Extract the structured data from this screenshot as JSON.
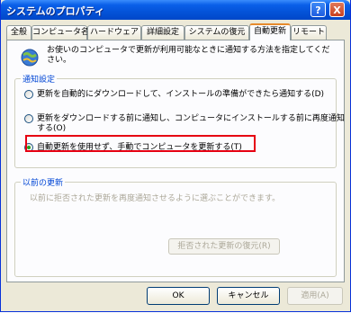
{
  "window": {
    "title": "システムのプロパティ",
    "help_label": "?",
    "close_label": "X"
  },
  "tabs": [
    {
      "label": "全般"
    },
    {
      "label": "コンピュータ名"
    },
    {
      "label": "ハードウェア"
    },
    {
      "label": "詳細設定"
    },
    {
      "label": "システムの復元"
    },
    {
      "label": "自動更新",
      "active": true
    },
    {
      "label": "リモート"
    }
  ],
  "description": "お使いのコンピュータで更新が利用可能なときに通知する方法を指定してください。",
  "notify_group": {
    "label": "通知設定",
    "options": [
      {
        "label": "更新を自動的にダウンロードして、インストールの準備ができたら通知する(D)",
        "checked": false
      },
      {
        "label_line1": "更新をダウンロードする前に通知し、コンピュータにインストールする前に再度通知",
        "label_line2": "する(O)",
        "checked": false
      },
      {
        "label": "自動更新を使用せず、手動でコンピュータを更新する(T)",
        "checked": true
      }
    ]
  },
  "previous_group": {
    "label": "以前の更新",
    "text": "以前に拒否された更新を再度通知させるように選ぶことができます。",
    "restore_button": "拒否された更新の復元(R)"
  },
  "buttons": {
    "ok": "OK",
    "cancel": "キャンセル",
    "apply": "適用(A)"
  },
  "colors": {
    "highlight": "#e60012",
    "titlebar": "#0453d9",
    "group_label": "#0046d5"
  }
}
